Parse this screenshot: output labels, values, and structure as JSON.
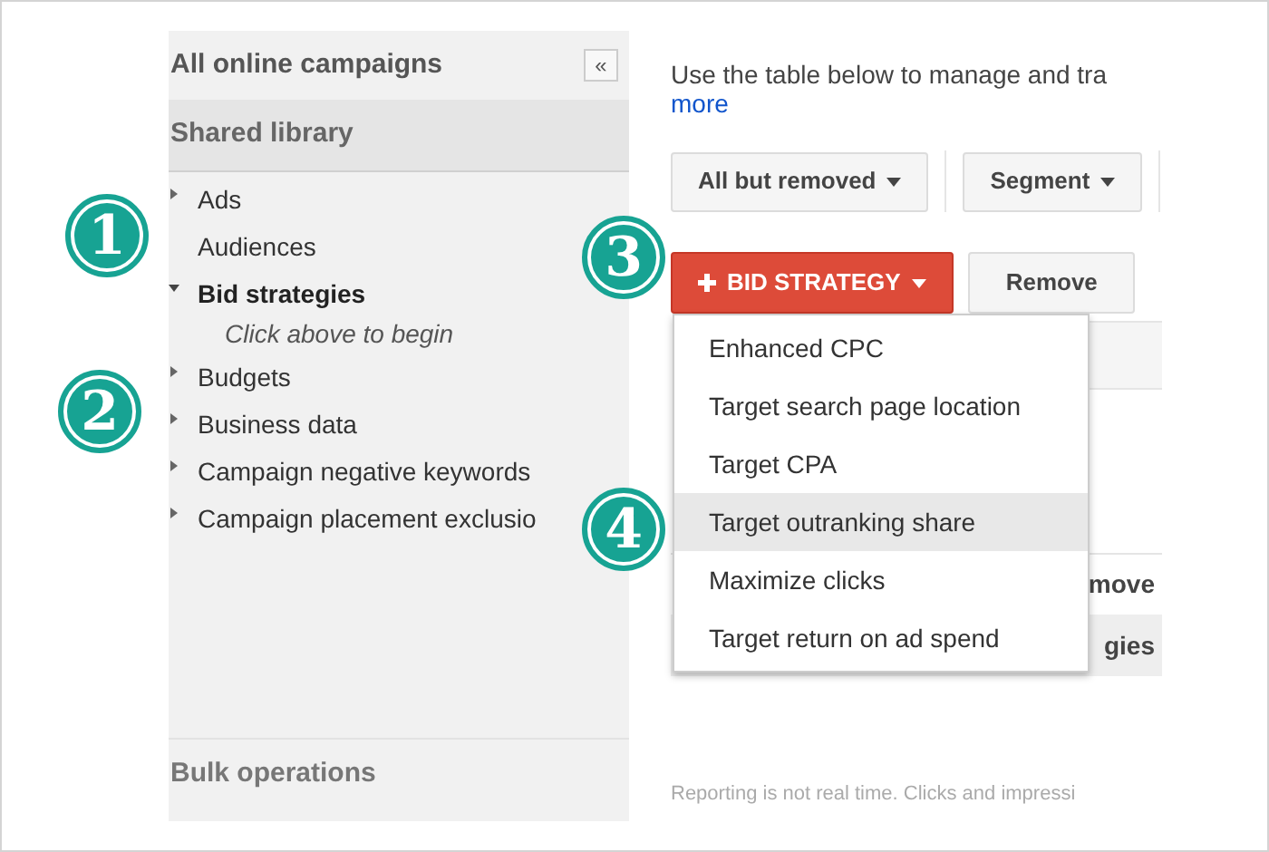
{
  "sidebar": {
    "title": "All online campaigns",
    "collapse_button": "«",
    "section": "Shared library",
    "items": [
      {
        "label": "Ads",
        "kind": "collapsed"
      },
      {
        "label": "Audiences",
        "kind": "plain"
      },
      {
        "label": "Bid strategies",
        "kind": "expanded",
        "children": [
          {
            "label": "Click above to begin",
            "kind": "hint"
          }
        ]
      },
      {
        "label": "Budgets",
        "kind": "collapsed"
      },
      {
        "label": "Business data",
        "kind": "collapsed"
      },
      {
        "label": "Campaign negative keywords",
        "kind": "collapsed"
      },
      {
        "label": "Campaign placement exclusio",
        "kind": "collapsed"
      }
    ],
    "footer": "Bulk operations"
  },
  "main": {
    "intro": "Use the table below to manage and tra",
    "more_link": "more",
    "filters": [
      "All but removed",
      "Segment"
    ],
    "bid_strategy_button": "BID STRATEGY",
    "remove_button": "Remove",
    "menu": [
      {
        "label": "Enhanced CPC",
        "selected": false
      },
      {
        "label": "Target search page location",
        "selected": false
      },
      {
        "label": "Target CPA",
        "selected": false
      },
      {
        "label": "Target outranking share",
        "selected": true
      },
      {
        "label": "Maximize clicks",
        "selected": false
      },
      {
        "label": "Target return on ad spend",
        "selected": false
      }
    ],
    "hidden_row_texts": [
      "move",
      "gies"
    ],
    "footnote": "Reporting is not real time. Clicks and impressi"
  },
  "callouts": [
    {
      "label": "1"
    },
    {
      "label": "2"
    },
    {
      "label": "3"
    },
    {
      "label": "4"
    }
  ]
}
